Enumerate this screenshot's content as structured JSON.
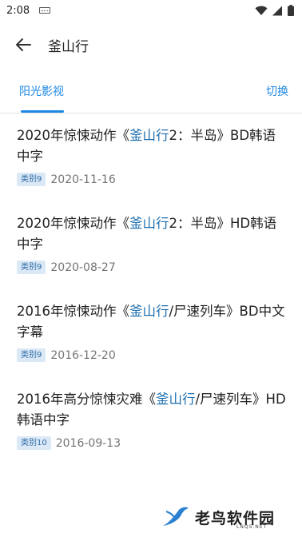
{
  "status": {
    "time": "2:08",
    "icons": [
      "keyboard-icon",
      "wifi-icon",
      "signal-icon",
      "battery-icon"
    ]
  },
  "appbar": {
    "back_icon": "arrow-back-icon",
    "title": "釜山行"
  },
  "tabs": {
    "active_label": "阳光影视",
    "switch_label": "切换"
  },
  "items": [
    {
      "title_pre": "2020年惊悚动作《",
      "title_hl": "釜山行",
      "title_post": "2：半岛》BD韩语中字",
      "badge": "类别9",
      "date": "2020-11-16"
    },
    {
      "title_pre": "2020年惊悚动作《",
      "title_hl": "釜山行",
      "title_post": "2：半岛》HD韩语中字",
      "badge": "类别9",
      "date": "2020-08-27"
    },
    {
      "title_pre": "2016年惊悚动作《",
      "title_hl": "釜山行",
      "title_post": "/尸速列车》BD中文字幕",
      "badge": "类别9",
      "date": "2016-12-20"
    },
    {
      "title_pre": "2016年高分惊悚灾难《",
      "title_hl": "釜山行",
      "title_post": "/尸速列车》HD韩语中字",
      "badge": "类别10",
      "date": "2016-09-13"
    }
  ],
  "watermark": {
    "text": "老鸟软件园",
    "sub": "LNQS.NET"
  },
  "colors": {
    "accent": "#1e88e5",
    "highlight": "#1e6fb0",
    "badge_bg": "#dbe9f7",
    "badge_text": "#2d6aa3"
  }
}
